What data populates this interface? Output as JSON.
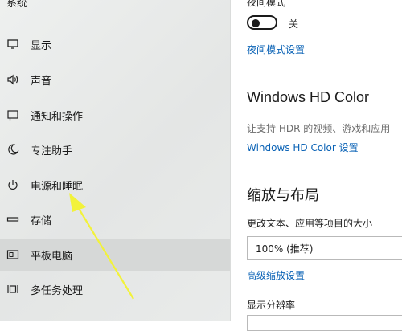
{
  "sidebar": {
    "header": "系统",
    "items": [
      {
        "label": "显示",
        "icon": "monitor-icon"
      },
      {
        "label": "声音",
        "icon": "speaker-icon"
      },
      {
        "label": "通知和操作",
        "icon": "notification-icon"
      },
      {
        "label": "专注助手",
        "icon": "moon-icon"
      },
      {
        "label": "电源和睡眠",
        "icon": "power-icon"
      },
      {
        "label": "存储",
        "icon": "storage-icon"
      },
      {
        "label": "平板电脑",
        "icon": "tablet-icon"
      },
      {
        "label": "多任务处理",
        "icon": "multitask-icon"
      }
    ],
    "selected": "平板电脑"
  },
  "night_light": {
    "title": "夜间模式",
    "toggle_state": "关",
    "settings_link": "夜间模式设置"
  },
  "hd_color": {
    "heading": "Windows HD Color",
    "description": "让支持 HDR 的视频、游戏和应用",
    "settings_link": "Windows HD Color 设置"
  },
  "scale_layout": {
    "heading": "缩放与布局",
    "scale_label": "更改文本、应用等项目的大小",
    "scale_value": "100% (推荐)",
    "advanced_link": "高级缩放设置",
    "resolution_label": "显示分辨率"
  },
  "colors": {
    "link": "#0b63b6",
    "annotation_arrow": "#f2f23a"
  }
}
